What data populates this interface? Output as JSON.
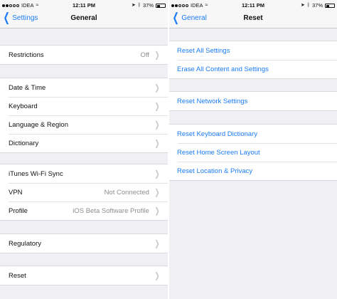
{
  "status_left": {
    "carrier": "IDEA",
    "time": "12:11 PM",
    "battery": "37%"
  },
  "status_right": {
    "carrier": "IDEA",
    "time": "12:11 PM",
    "battery": "37%"
  },
  "left_screen": {
    "back_label": "Settings",
    "title": "General",
    "groups": [
      [
        {
          "label": "Restrictions",
          "value": "Off"
        }
      ],
      [
        {
          "label": "Date & Time",
          "value": ""
        },
        {
          "label": "Keyboard",
          "value": ""
        },
        {
          "label": "Language & Region",
          "value": ""
        },
        {
          "label": "Dictionary",
          "value": ""
        }
      ],
      [
        {
          "label": "iTunes Wi-Fi Sync",
          "value": ""
        },
        {
          "label": "VPN",
          "value": "Not Connected"
        },
        {
          "label": "Profile",
          "value": "iOS Beta Software Profile"
        }
      ],
      [
        {
          "label": "Regulatory",
          "value": ""
        }
      ],
      [
        {
          "label": "Reset",
          "value": ""
        }
      ]
    ]
  },
  "right_screen": {
    "back_label": "General",
    "title": "Reset",
    "groups": [
      [
        {
          "label": "Reset All Settings"
        },
        {
          "label": "Erase All Content and Settings"
        }
      ],
      [
        {
          "label": "Reset Network Settings"
        }
      ],
      [
        {
          "label": "Reset Keyboard Dictionary"
        },
        {
          "label": "Reset Home Screen Layout"
        },
        {
          "label": "Reset Location & Privacy"
        }
      ]
    ]
  },
  "icons": {
    "disclosure": "chevron-right-icon",
    "back": "chevron-left-icon",
    "location": "location-arrow-icon",
    "bluetooth": "bluetooth-icon",
    "battery": "battery-icon",
    "signal": "signal-dots-icon",
    "wifi": "wifi-icon"
  },
  "colors": {
    "tint": "#1b7cf6",
    "background": "#efeff4",
    "secondary_text": "#8e8e93"
  }
}
